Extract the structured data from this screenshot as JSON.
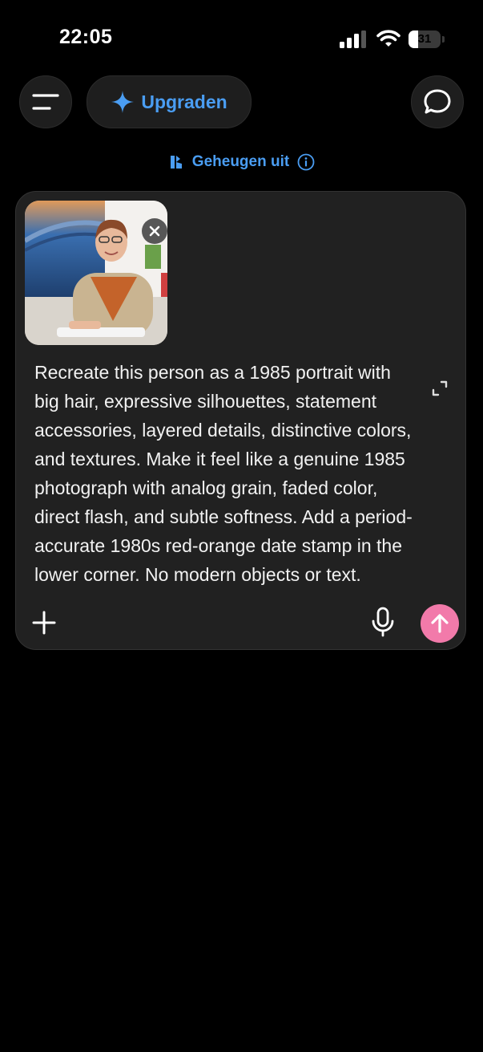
{
  "status_bar": {
    "time": "22:05",
    "battery_percent": "31",
    "battery_level": 0.31
  },
  "header": {
    "menu_icon": "menu-icon",
    "upgrade_label": "Upgraden",
    "upgrade_icon": "sparkle-icon",
    "new_chat_icon": "chat-bubble-icon"
  },
  "memory_notice": {
    "label": "Geheugen uit",
    "icon": "memory-icon",
    "info_icon": "info-icon"
  },
  "composer": {
    "attachment": {
      "description_icon": "photo-thumbnail",
      "remove_icon": "close-icon"
    },
    "prompt_text": "Recreate this person as a 1985 portrait with big hair, expressive silhouettes, statement accessories, layered details, distinctive colors, and textures. Make it feel like a genuine 1985 photograph with analog grain, faded color, direct flash, and subtle softness. Add a period-accurate 1980s red-orange date stamp in the lower corner. No modern objects or text.",
    "expand_icon": "expand-icon",
    "add_icon": "plus-icon",
    "mic_icon": "microphone-icon",
    "send_icon": "arrow-up-icon"
  },
  "colors": {
    "accent": "#4a9df2",
    "send_button": "#f27aaa",
    "composer_bg": "#212121"
  }
}
